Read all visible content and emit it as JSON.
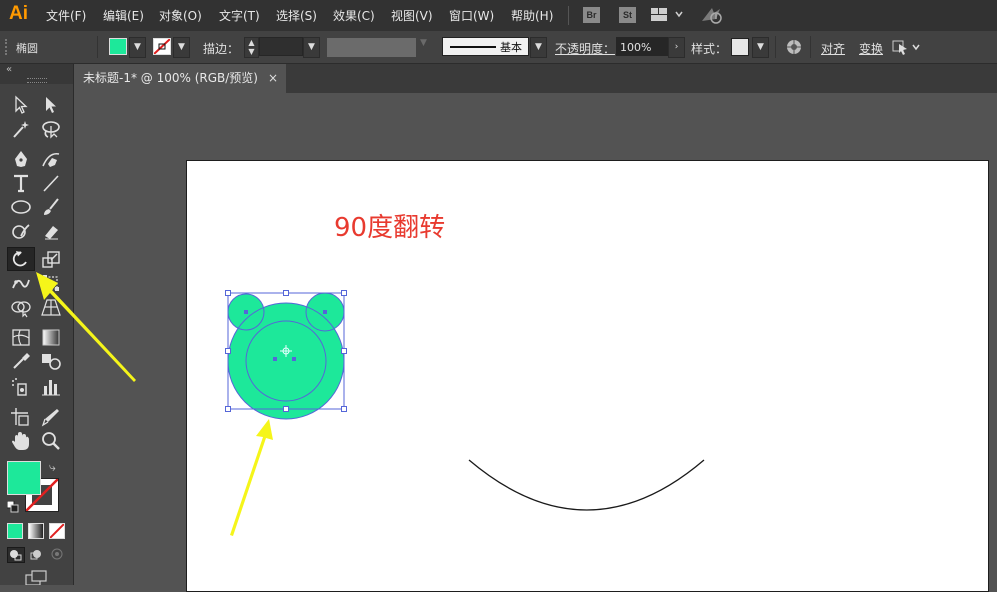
{
  "app": {
    "logo": "Ai"
  },
  "menu": [
    {
      "label": "文件(F)"
    },
    {
      "label": "编辑(E)"
    },
    {
      "label": "对象(O)"
    },
    {
      "label": "文字(T)"
    },
    {
      "label": "选择(S)"
    },
    {
      "label": "效果(C)"
    },
    {
      "label": "视图(V)"
    },
    {
      "label": "窗口(W)"
    },
    {
      "label": "帮助(H)"
    }
  ],
  "bridge": {
    "br": "Br",
    "st": "St"
  },
  "options": {
    "object_label": "椭圆",
    "fill_color": "#1de89a",
    "stroke_label": "描边：",
    "stroke_style": "基本",
    "opacity_label": "不透明度：",
    "opacity_value": "100%",
    "style_label": "样式：",
    "align_label": "对齐",
    "transform_label": "变换"
  },
  "tab": {
    "title": "未标题-1* @ 100% (RGB/预览)",
    "close": "×"
  },
  "canvas": {
    "annotation": "90度翻转",
    "annotation_color": "#e83a2f",
    "shape_fill": "#1de89a",
    "arrow_color": "#f5f51a"
  },
  "toolbox": {
    "fill_color": "#1de89a",
    "stroke_color": "#ffffff"
  }
}
